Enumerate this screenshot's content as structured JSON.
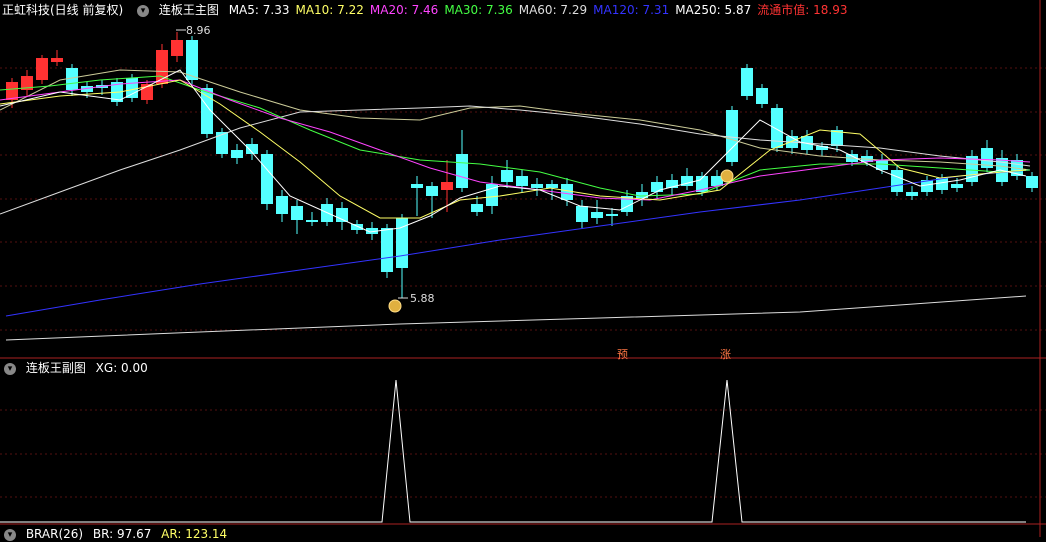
{
  "main_header": {
    "stock": "正虹科技(日线 前复权)",
    "panel": "连板王主图",
    "indicators": [
      {
        "label": "MA5: 7.33",
        "color": "#ffffff"
      },
      {
        "label": "MA10: 7.22",
        "color": "#ffff66"
      },
      {
        "label": "MA20: 7.46",
        "color": "#ff44ff"
      },
      {
        "label": "MA30: 7.36",
        "color": "#44ff44"
      },
      {
        "label": "MA60: 7.29",
        "color": "#dddddd"
      },
      {
        "label": "MA120: 7.31",
        "color": "#3333ff"
      },
      {
        "label": "MA250: 5.87",
        "color": "#ffffff"
      },
      {
        "label": "流通市值: 18.93",
        "color": "#ff3333"
      }
    ]
  },
  "sub_header": {
    "panel": "连板王副图",
    "value": "XG: 0.00"
  },
  "bottom_header": {
    "panel": "BRAR(26)",
    "br": "BR: 97.67",
    "ar": "AR: 123.14"
  },
  "annotations": {
    "high": "8.96",
    "low": "5.88",
    "tag_pre": "预",
    "tag_up": "涨"
  },
  "chart_data": {
    "type": "candlestick",
    "series_colors": {
      "up": "#ff3232",
      "down": "#54ffff"
    },
    "high_price": 8.96,
    "low_price": 5.88,
    "xg_signals": [
      26,
      48
    ]
  }
}
